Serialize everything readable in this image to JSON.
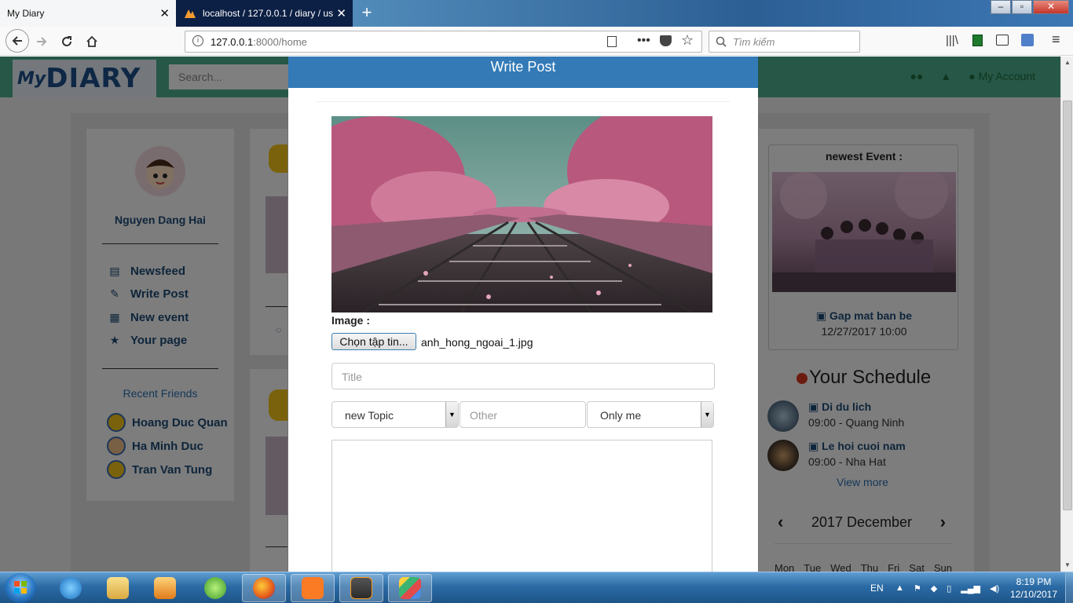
{
  "browser": {
    "tabs": [
      {
        "title": "My Diary"
      },
      {
        "title": "localhost / 127.0.0.1 / diary / us"
      }
    ],
    "url_host": "127.0.0.1",
    "url_rest": ":8000/home",
    "search_placeholder": "Tìm kiếm"
  },
  "site": {
    "logo_my": "My",
    "logo_diary": "DIARY",
    "search_placeholder": "Search...",
    "account_label": "My Account"
  },
  "sidebar": {
    "username": "Nguyen Dang Hai",
    "menu": [
      {
        "label": "Newsfeed",
        "icon": "newspaper-icon"
      },
      {
        "label": "Write Post",
        "icon": "edit-icon"
      },
      {
        "label": "New event",
        "icon": "calendar-icon"
      },
      {
        "label": "Your page",
        "icon": "star-icon"
      }
    ],
    "recent_title": "Recent Friends",
    "friends": [
      "Hoang Duc Quan",
      "Ha Minh Duc",
      "Tran Van Tung"
    ]
  },
  "right": {
    "event_title": "newest Event :",
    "event_name": "Gap mat ban be",
    "event_time": "12/27/2017 10:00",
    "schedule_title": "Your Schedule",
    "schedule": [
      {
        "name": "Di du lich",
        "time": "09:00 - Quang Ninh"
      },
      {
        "name": "Le hoi cuoi nam",
        "time": "09:00 - Nha Hat"
      }
    ],
    "view_more": "View more",
    "calendar_title": "2017 December",
    "weekdays": [
      "Mon",
      "Tue",
      "Wed",
      "Thu",
      "Fri",
      "Sat",
      "Sun"
    ]
  },
  "modal": {
    "title": "Write Post",
    "image_label": "Image :",
    "file_button": "Chọn tập tin...",
    "file_name": "anh_hong_ngoai_1.jpg",
    "title_placeholder": "Title",
    "topic_selected": "new Topic",
    "other_placeholder": "Other",
    "privacy_selected": "Only me"
  },
  "taskbar": {
    "language": "EN",
    "time": "8:19 PM",
    "date": "12/10/2017"
  },
  "colors": {
    "modal_header": "#337ab7",
    "site_header": "#4caf8e",
    "link": "#1d4a76"
  }
}
